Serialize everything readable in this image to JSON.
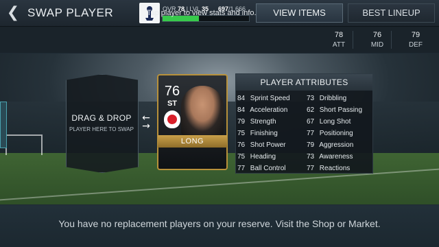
{
  "header": {
    "title": "SWAP PLAYER",
    "ovr_label": "OVR",
    "ovr_value": "78",
    "lvl_label": "LVL",
    "lvl_value": "35",
    "xp_current": "697",
    "xp_total": "/1,666",
    "xp_fraction": 0.418,
    "view_items_label": "VIEW ITEMS",
    "best_lineup_label": "BEST LINEUP"
  },
  "infobar": {
    "hint": "Tap player to view stats and info.",
    "stats": [
      {
        "value": "78",
        "label": "ATT"
      },
      {
        "value": "76",
        "label": "MID"
      },
      {
        "value": "79",
        "label": "DEF"
      }
    ]
  },
  "drag_drop": {
    "title": "DRAG & DROP",
    "subtitle": "PLAYER HERE TO SWAP"
  },
  "player_card": {
    "rating": "76",
    "position": "ST",
    "name": "LONG"
  },
  "attributes": {
    "title": "PLAYER ATTRIBUTES",
    "left": [
      {
        "value": "84",
        "name": "Sprint Speed"
      },
      {
        "value": "84",
        "name": "Acceleration"
      },
      {
        "value": "79",
        "name": "Strength"
      },
      {
        "value": "75",
        "name": "Finishing"
      },
      {
        "value": "76",
        "name": "Shot Power"
      },
      {
        "value": "75",
        "name": "Heading"
      },
      {
        "value": "77",
        "name": "Ball Control"
      }
    ],
    "right": [
      {
        "value": "73",
        "name": "Dribbling"
      },
      {
        "value": "62",
        "name": "Short Passing"
      },
      {
        "value": "67",
        "name": "Long Shot"
      },
      {
        "value": "77",
        "name": "Positioning"
      },
      {
        "value": "79",
        "name": "Aggression"
      },
      {
        "value": "73",
        "name": "Awareness"
      },
      {
        "value": "77",
        "name": "Reactions"
      }
    ]
  },
  "footer": {
    "message": "You have no replacement players on your reserve. Visit the Shop or Market."
  },
  "colors": {
    "xp_bar": "#37c94b",
    "card_border": "#b8913a",
    "background": "#1e2a33"
  },
  "icons": {
    "back": "back-arrow-icon",
    "swap": "swap-arrows-icon"
  }
}
